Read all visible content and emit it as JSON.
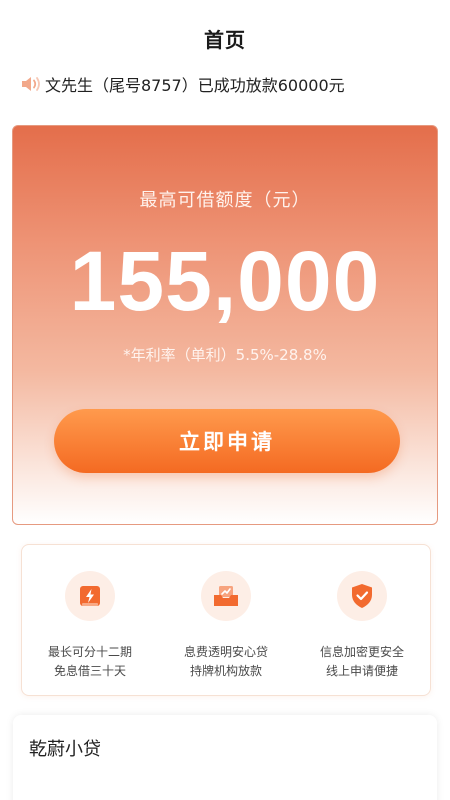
{
  "header": {
    "title": "首页"
  },
  "notice": {
    "icon": "speaker-icon",
    "text": "文先生（尾号8757）已成功放款60000元"
  },
  "hero": {
    "label": "最高可借额度（元）",
    "amount": "155,000",
    "rate": "*年利率（单利）5.5%-28.8%",
    "apply_label": "立即申请"
  },
  "features": [
    {
      "icon": "lightning-icon",
      "line1": "最长可分十二期",
      "line2": "免息借三十天"
    },
    {
      "icon": "chart-inbox-icon",
      "line1": "息费透明安心贷",
      "line2": "持牌机构放款"
    },
    {
      "icon": "shield-check-icon",
      "line1": "信息加密更安全",
      "line2": "线上申请便捷"
    }
  ],
  "product": {
    "name": "乾蔚小贷"
  },
  "colors": {
    "accent": "#f46a22",
    "hero_top": "#e46e4b",
    "icon_orange": "#f26a2f"
  }
}
